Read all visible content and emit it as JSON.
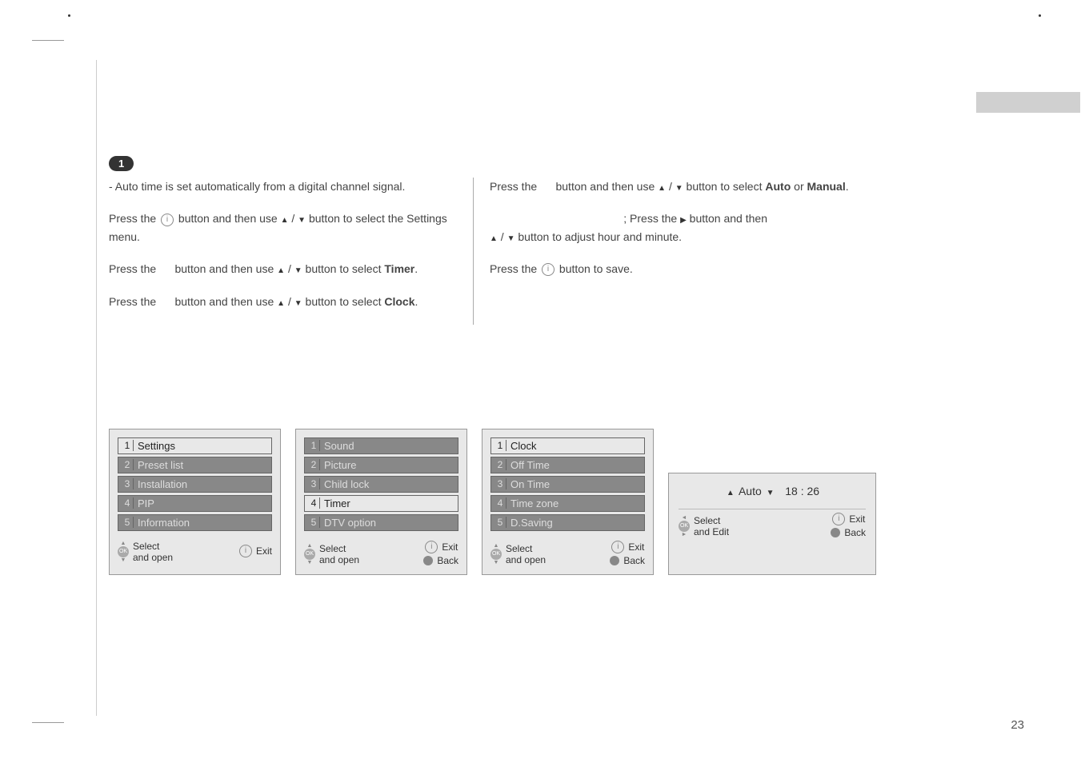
{
  "step": "1",
  "instructions": {
    "autoTimeNote": "- Auto time is set automatically from a digital channel signal.",
    "pressI1_a": "Press the",
    "pressI1_b": "button and then use",
    "pressI1_c": "button to select the Settings menu.",
    "pressTimer_a": "Press the",
    "pressTimer_b": "button and then use",
    "pressTimer_c": "button to select",
    "timerLabel": "Timer",
    "pressClock_a": "Press the",
    "pressClock_b": "button and then use",
    "pressClock_c": "button to select",
    "clockLabel": "Clock",
    "pressAutoManual_a": "Press the",
    "pressAutoManual_b": "button and then use",
    "pressAutoManual_c": "button to select",
    "autoLabel": "Auto",
    "orText": "or",
    "manualLabel": "Manual",
    "manualAdjust_a": "; Press the",
    "manualAdjust_b": "button and then",
    "manualAdjust_c": "button to adjust hour and minute.",
    "pressSave_a": "Press the",
    "pressSave_b": "button to save."
  },
  "menu1": {
    "items": [
      {
        "num": "1",
        "label": "Settings",
        "active": true
      },
      {
        "num": "2",
        "label": "Preset list",
        "active": false
      },
      {
        "num": "3",
        "label": "Installation",
        "active": false
      },
      {
        "num": "4",
        "label": "PIP",
        "active": false
      },
      {
        "num": "5",
        "label": "Information",
        "active": false
      }
    ],
    "footerSelect": "Select and open",
    "footerExit": "Exit"
  },
  "menu2": {
    "items": [
      {
        "num": "1",
        "label": "Sound",
        "active": false
      },
      {
        "num": "2",
        "label": "Picture",
        "active": false
      },
      {
        "num": "3",
        "label": "Child lock",
        "active": false
      },
      {
        "num": "4",
        "label": "Timer",
        "active": true
      },
      {
        "num": "5",
        "label": "DTV option",
        "active": false
      }
    ],
    "footerSelect": "Select and open",
    "footerExit": "Exit",
    "footerBack": "Back"
  },
  "menu3": {
    "items": [
      {
        "num": "1",
        "label": "Clock",
        "active": true
      },
      {
        "num": "2",
        "label": "Off Time",
        "active": false
      },
      {
        "num": "3",
        "label": "On Time",
        "active": false
      },
      {
        "num": "4",
        "label": "Time zone",
        "active": false
      },
      {
        "num": "5",
        "label": "D.Saving",
        "active": false
      }
    ],
    "footerSelect": "Select and open",
    "footerExit": "Exit",
    "footerBack": "Back"
  },
  "clockPanel": {
    "mode": "Auto",
    "time": "18 : 26",
    "footerSelect": "Select and Edit",
    "footerExit": "Exit",
    "footerBack": "Back"
  },
  "pageNumber": "23"
}
